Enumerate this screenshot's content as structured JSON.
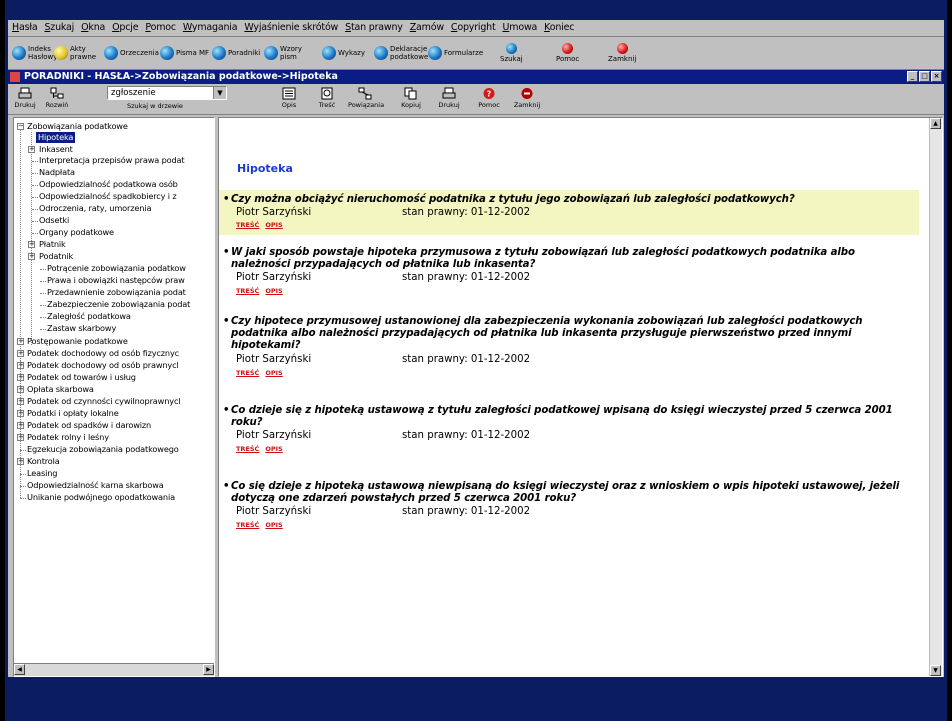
{
  "menu": [
    "Hasła",
    "Szukaj",
    "Okna",
    "Opcje",
    "Pomoc",
    "Wymagania",
    "Wyjaśnienie skrótów",
    "Stan prawny",
    "Zamów",
    "Copyright",
    "Umowa",
    "Koniec"
  ],
  "quickbar": [
    {
      "label": "Indeks Hasłowy",
      "icon": "index-icon"
    },
    {
      "label": "Akty prawne",
      "icon": "acts-icon"
    },
    {
      "label": "Orzeczenia",
      "icon": "rulings-icon"
    },
    {
      "label": "Pisma MF",
      "icon": "letters-icon"
    },
    {
      "label": "Poradniki",
      "icon": "guides-icon"
    },
    {
      "label": "Wzory pism",
      "icon": "templates-icon"
    },
    {
      "label": "Wykazy",
      "icon": "lists-icon"
    },
    {
      "label": "Deklaracje podatkowe",
      "icon": "declarations-icon"
    },
    {
      "label": "Formularze",
      "icon": "forms-icon"
    },
    {
      "label": "Szukaj",
      "icon": "search-icon"
    },
    {
      "label": "Pomoc",
      "icon": "help-icon"
    },
    {
      "label": "Zamknij",
      "icon": "close-icon"
    }
  ],
  "window": {
    "title": "PORADNIKI - HASŁA->Zobowiązania podatkowe->Hipoteka",
    "caps": [
      "_",
      "□",
      "×"
    ]
  },
  "toolbar": {
    "drukuj": "Drukuj",
    "rozwin": "Rozwiń",
    "search_value": "zgłoszenie",
    "search_caption": "Szukaj w drzewie",
    "buttons": [
      "Opis",
      "Treść",
      "Powiązania",
      "Kopiuj",
      "Drukuj",
      "Pomoc",
      "Zamknij"
    ]
  },
  "tree": {
    "root": "Zobowiązania podatkowe",
    "children": [
      "Hipoteka",
      "Inkasent",
      "Interpretacja przepisów prawa podat",
      "Nadpłata",
      "Odpowiedzialność podatkowa osób",
      "Odpowiedzialność spadkobiercy i z",
      "Odroczenia, raty, umorzenia",
      "Odsetki",
      "Organy podatkowe",
      "Płatnik",
      "Podatnik",
      "Potrącenie zobowiązania podatkow",
      "Prawa i obowiązki następców praw",
      "Przedawnienie zobowiązania podat",
      "Zabezpieczenie zobowiązania podat",
      "Zaległość podatkowa",
      "Zastaw skarbowy"
    ],
    "top": [
      "Postępowanie podatkowe",
      "Podatek dochodowy od osób fizycznyc",
      "Podatek dochodowy od osób prawnycl",
      "Podatek od towarów i usług",
      "Opłata skarbowa",
      "Podatek od czynności cywilnoprawnycl",
      "Podatki i opłaty lokalne",
      "Podatek od spadków i darowizn",
      "Podatek rolny i leśny",
      "Egzekucja zobowiązania podatkowego",
      "Kontrola",
      "Leasing",
      "Odpowiedzialność karna skarbowa",
      "Unikanie podwójnego opodatkowania"
    ]
  },
  "content": {
    "title": "Hipoteka",
    "tresc": "TREŚĆ",
    "opis": "OPIS",
    "entries": [
      {
        "lines": [
          "Czy można obciążyć nieruchomość podatnika z tytułu jego zobowiązań lub zaległości podatkowych?"
        ],
        "author": "Piotr Sarzyński",
        "stan": "stan prawny: 01-12-2002"
      },
      {
        "lines": [
          "W jaki sposób powstaje hipoteka przymusowa z tytułu zobowiązań lub zaległości podatkowych podatnika albo",
          "należności przypadających od płatnika lub inkasenta?"
        ],
        "author": "Piotr Sarzyński",
        "stan": "stan prawny: 01-12-2002"
      },
      {
        "lines": [
          "Czy hipotece przymusowej ustanowionej dla zabezpieczenia wykonania zobowiązań lub zaległości podatkowych",
          "podatnika albo należności przypadających od płatnika lub inkasenta przysługuje pierwszeństwo przed innymi",
          "hipotekami?"
        ],
        "author": "Piotr Sarzyński",
        "stan": "stan prawny: 01-12-2002"
      },
      {
        "lines": [
          "Co dzieje się z hipoteką ustawową z tytułu zaległości podatkowej wpisaną do księgi wieczystej przed 5 czerwca 2001",
          "roku?"
        ],
        "author": "Piotr Sarzyński",
        "stan": "stan prawny: 01-12-2002"
      },
      {
        "lines": [
          "Co się dzieje z hipoteką ustawową niewpisaną do księgi wieczystej oraz z wnioskiem o wpis hipoteki ustawowej, jeżeli",
          "dotyczą one zdarzeń powstałych przed 5 czerwca 2001 roku?"
        ],
        "author": "Piotr Sarzyński",
        "stan": "stan prawny: 01-12-2002"
      }
    ]
  }
}
